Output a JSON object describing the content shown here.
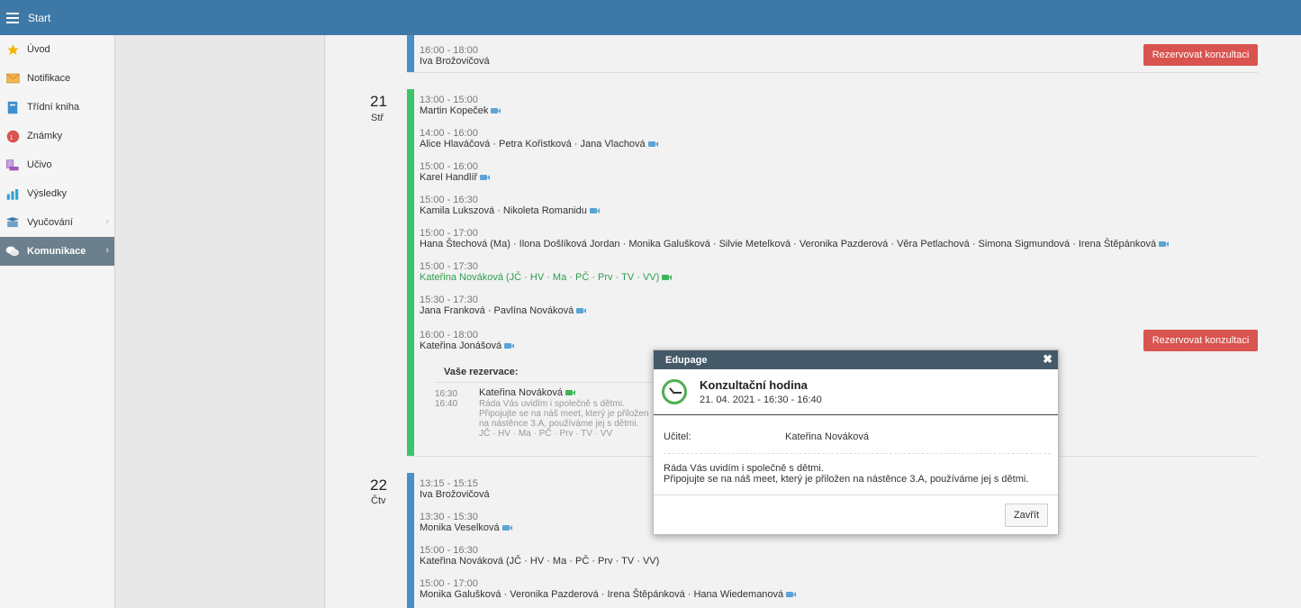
{
  "topbar": {
    "title": "Start"
  },
  "sidebar": {
    "items": [
      {
        "label": "Úvod",
        "icon": "star-icon",
        "color": "#f0b400"
      },
      {
        "label": "Notifikace",
        "icon": "envelope-icon",
        "color": "#e8a33a"
      },
      {
        "label": "Třídní kniha",
        "icon": "book-icon",
        "color": "#3d8fd0"
      },
      {
        "label": "Známky",
        "icon": "grades-icon",
        "color": "#d9534f"
      },
      {
        "label": "Učivo",
        "icon": "curriculum-icon",
        "color": "#9c5bb8"
      },
      {
        "label": "Výsledky",
        "icon": "bar-chart-icon",
        "color": "#2aa3d6"
      },
      {
        "label": "Vyučování",
        "icon": "teaching-icon",
        "color": "#3d78a6"
      },
      {
        "label": "Komunikace",
        "icon": "chat-icon",
        "color": "#ffffff"
      }
    ]
  },
  "schedule": {
    "top_slot": {
      "time": "16:00 - 18:00",
      "names": "Iva Brožovičová"
    },
    "reserve_label": "Rezervovat konzultaci",
    "day21": {
      "num": "21",
      "name": "Stř",
      "slots": [
        {
          "time": "13:00 - 15:00",
          "names": "Martin Kopeček"
        },
        {
          "time": "14:00 - 16:00",
          "names": "Alice Hlaváčová · Petra Kořistková · Jana Vlachová"
        },
        {
          "time": "15:00 - 16:00",
          "names": "Karel Handlíř"
        },
        {
          "time": "15:00 - 16:30",
          "names": "Kamila Lukszová · Nikoleta Romanidu"
        },
        {
          "time": "15:00 - 17:00",
          "names": "Hana Štechová (Ma) · Ilona Došlíková Jordan · Monika Galušková · Silvie Metelková · Veronika Pazderová · Věra Petlachová · Simona Sigmundová · Irena Štěpánková"
        },
        {
          "time": "15:00 - 17:30",
          "names": "Kateřina Nováková (JČ · HV · Ma · PČ · Prv · TV · VV)"
        },
        {
          "time": "15:30 - 17:30",
          "names": "Jana Franková · Pavlína Nováková"
        },
        {
          "time": "16:00 - 18:00",
          "names": "Kateřina Jonášová"
        }
      ]
    },
    "reservations": {
      "title": "Vaše rezervace:",
      "time_from": "16:30",
      "time_to": "16:40",
      "name": "Kateřina Nováková",
      "note_line1": "Ráda Vás uvidím i společně s dětmi.",
      "note_line2": "Připojujte se na náš meet, který je přiložen",
      "note_line3": "na nástěnce 3.A, používáme jej s dětmi.",
      "subjects": "JČ · HV · Ma · PČ · Prv · TV · VV"
    },
    "day22": {
      "num": "22",
      "name": "Čtv",
      "slots": [
        {
          "time": "13:15 - 15:15",
          "names": "Iva Brožovičová"
        },
        {
          "time": "13:30 - 15:30",
          "names": "Monika Veselková"
        },
        {
          "time": "15:00 - 16:30",
          "names": "Kateřina Nováková (JČ · HV · Ma · PČ · Prv · TV · VV)"
        },
        {
          "time": "15:00 - 17:00",
          "names": "Monika Galušková · Veronika Pazderová · Irena Štěpánková · Hana Wiedemanová"
        }
      ]
    }
  },
  "dialog": {
    "header": "Edupage",
    "title": "Konzultační hodina",
    "subtitle": "21. 04. 2021 - 16:30 - 16:40",
    "teacher_label": "Učitel:",
    "teacher_value": "Kateřina Nováková",
    "message_line1": "Ráda Vás uvidím i společně s dětmi.",
    "message_line2": "Připojujte se na náš meet, který je přiložen na nástěnce 3.A, používáme jej s dětmi.",
    "close_button": "Zavřít"
  },
  "colors": {
    "topbar": "#3d78a6",
    "bar_blue": "#4a90c8",
    "bar_green": "#3cc46a",
    "reserve": "#d9534f",
    "dialog_header": "#455a68"
  }
}
